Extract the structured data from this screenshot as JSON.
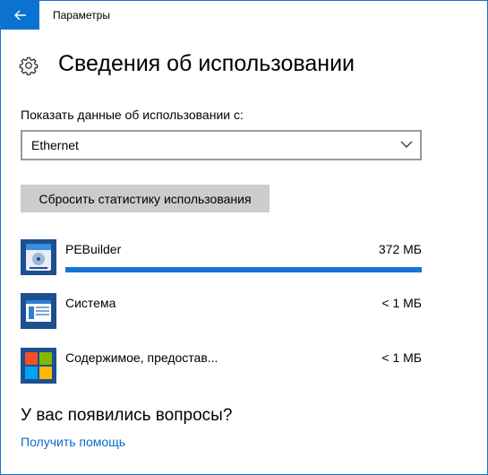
{
  "window": {
    "title": "Параметры"
  },
  "page": {
    "title": "Сведения об использовании"
  },
  "filter": {
    "label": "Показать данные об использовании с:",
    "selected": "Ethernet"
  },
  "reset_button": "Сбросить статистику использования",
  "apps": [
    {
      "name": "PEBuilder",
      "size": "372 МБ",
      "icon": "disc-drive-icon",
      "usage_fraction": 1.0
    },
    {
      "name": "Система",
      "size": "< 1 МБ",
      "icon": "system-window-icon"
    },
    {
      "name": "Содержимое, предостав...",
      "size": "< 1 МБ",
      "icon": "windows-logo-icon"
    }
  ],
  "help": {
    "heading": "У вас появились вопросы?",
    "link": "Получить помощь"
  },
  "colors": {
    "accent": "#0a73d1",
    "link": "#0a6ac8",
    "bar": "#1874d4"
  }
}
